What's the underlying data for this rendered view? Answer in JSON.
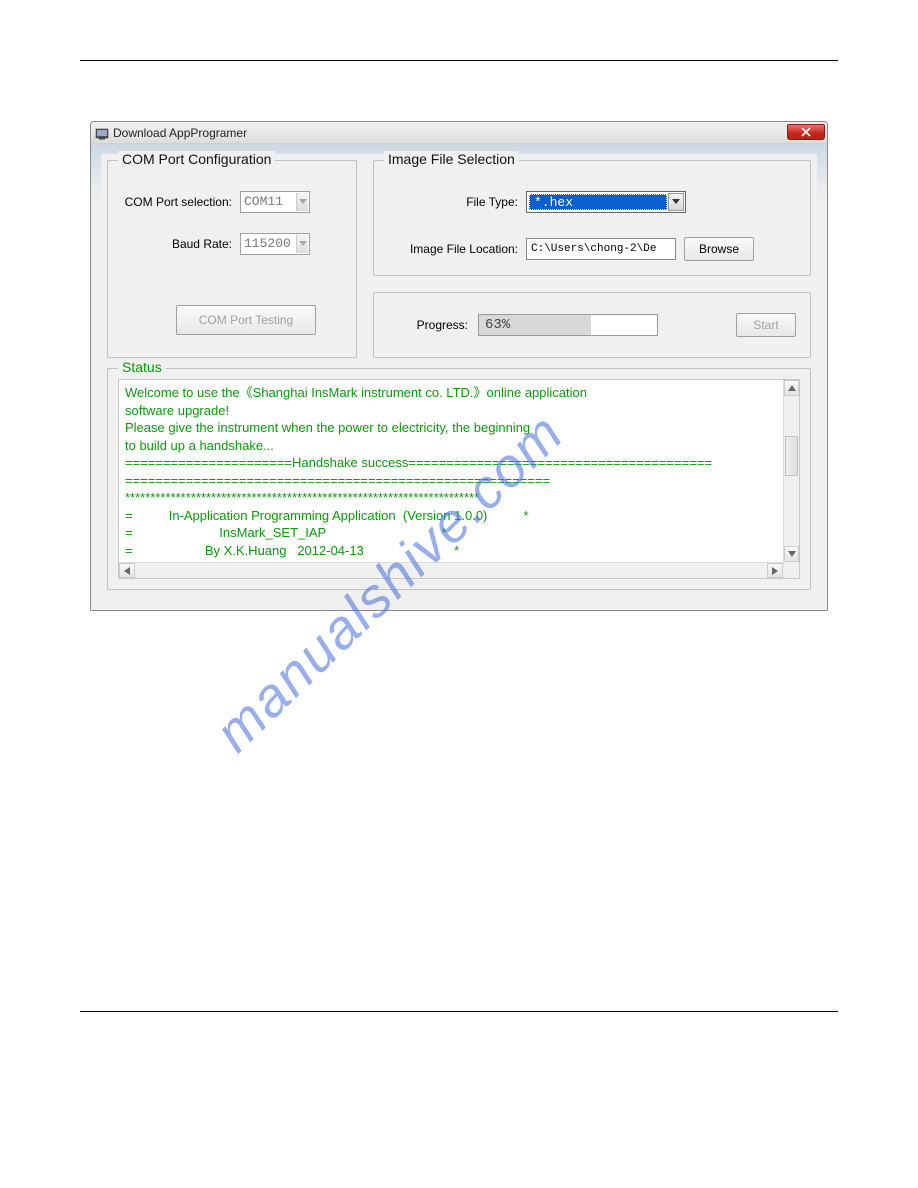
{
  "window": {
    "title": "Download AppProgramer"
  },
  "com": {
    "legend": "COM Port Configuration",
    "port_label": "COM Port selection:",
    "port_value": "COM11",
    "baud_label": "Baud Rate:",
    "baud_value": "115200",
    "test_button": "COM Port Testing"
  },
  "image": {
    "legend": "Image File Selection",
    "file_type_label": "File Type:",
    "file_type_value": "*.hex",
    "location_label": "Image File Location:",
    "location_value": "C:\\Users\\chong-2\\De",
    "browse_button": "Browse"
  },
  "progress": {
    "label": "Progress:",
    "percent_text": "63%",
    "percent_value": 63,
    "start_button": "Start"
  },
  "status": {
    "legend": "Status",
    "text": "Welcome to use the《Shanghai InsMark instrument co. LTD.》online application\nsoftware upgrade!\nPlease give the instrument when the power to electricity, the beginning\nto build up a handshake...\n======================Handshake success========================================\n========================================================\n**********************************************************************\n=          In-Application Programming Application  (Version 1.0.0)          *\n=                        InsMark_SET_IAP                                *\n=                    By X.K.Huang   2012-04-13                         *\n**********************************************************************"
  },
  "watermark": "manualshive.com"
}
